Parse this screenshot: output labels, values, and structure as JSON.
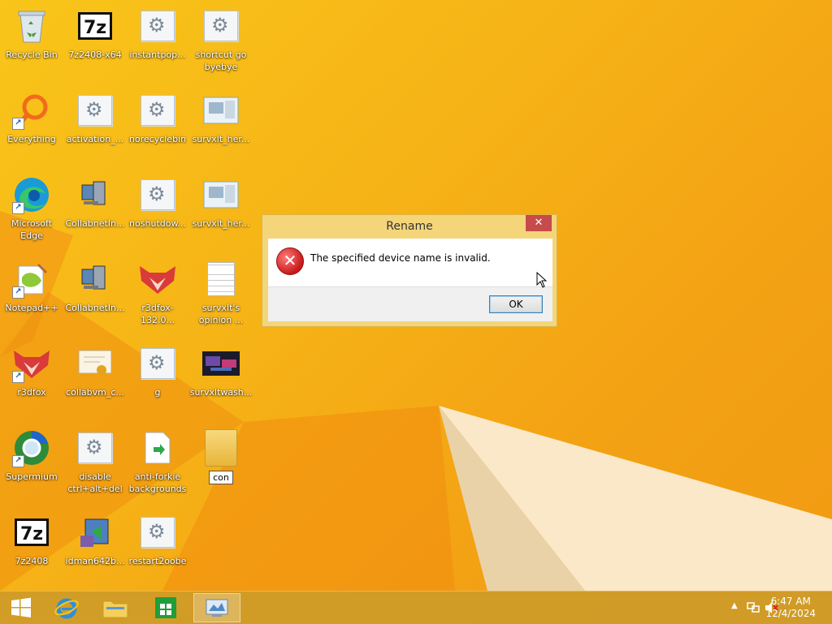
{
  "desktop": {
    "icons": [
      {
        "label": "Recycle Bin"
      },
      {
        "label": "7z2408-x64"
      },
      {
        "label": "instantpop..."
      },
      {
        "label": "shortcut go byebye"
      },
      {
        "label": "Everything"
      },
      {
        "label": "activation_..."
      },
      {
        "label": "norecyclebin"
      },
      {
        "label": "survxlt_her..."
      },
      {
        "label": "Microsoft Edge"
      },
      {
        "label": "CollabnetIn..."
      },
      {
        "label": "noshutdow..."
      },
      {
        "label": "survxlt_her..."
      },
      {
        "label": "Notepad++"
      },
      {
        "label": "CollabnetIn..."
      },
      {
        "label": "r3dfox-132.0..."
      },
      {
        "label": "survxlt's opinion ..."
      },
      {
        "label": "r3dfox"
      },
      {
        "label": "collabvm_c..."
      },
      {
        "label": "g"
      },
      {
        "label": "survxltwash..."
      },
      {
        "label": "Supermium"
      },
      {
        "label": "disable ctrl+alt+del"
      },
      {
        "label": "anti-forkie backgrounds"
      },
      {
        "label": "con"
      },
      {
        "label": "7z2408"
      },
      {
        "label": "idman642b..."
      },
      {
        "label": "restart2oobe"
      }
    ]
  },
  "dialog": {
    "title": "Rename",
    "close_label": "✕",
    "message": "The specified device name is invalid.",
    "ok_label": "OK",
    "icon": "error-icon"
  },
  "taskbar": {
    "items": [
      "start-icon",
      "internet-explorer-icon",
      "file-explorer-icon",
      "store-icon",
      "control-panel-icon"
    ],
    "tray": {
      "time": "6:47 AM",
      "date": "12/4/2024"
    }
  },
  "colors": {
    "wallpaper": "#f6b316",
    "dialog_frame": "#f4d57a",
    "close_button": "#c74b4b"
  }
}
